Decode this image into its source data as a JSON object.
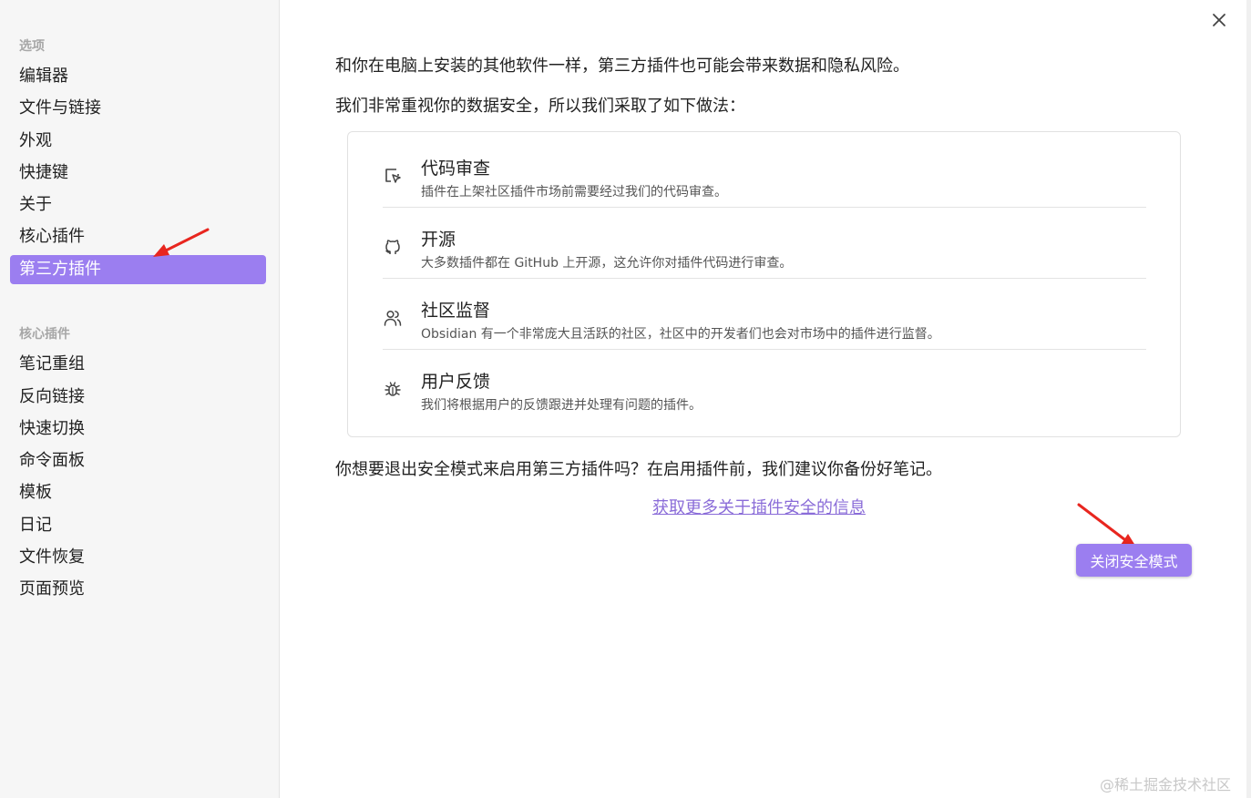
{
  "sidebar": {
    "section_options": "选项",
    "options_items": [
      "编辑器",
      "文件与链接",
      "外观",
      "快捷键",
      "关于",
      "核心插件",
      "第三方插件"
    ],
    "section_core_plugins": "核心插件",
    "core_items": [
      "笔记重组",
      "反向链接",
      "快速切换",
      "命令面板",
      "模板",
      "日记",
      "文件恢复",
      "页面预览"
    ]
  },
  "main": {
    "intro_line1": "和你在电脑上安装的其他软件一样，第三方插件也可能会带来数据和隐私风险。",
    "intro_line2": "我们非常重视你的数据安全，所以我们采取了如下做法：",
    "measures": [
      {
        "icon": "code-review-icon",
        "title": "代码审查",
        "desc": "插件在上架社区插件市场前需要经过我们的代码审查。"
      },
      {
        "icon": "github-icon",
        "title": "开源",
        "desc": "大多数插件都在 GitHub 上开源，这允许你对插件代码进行审查。"
      },
      {
        "icon": "users-icon",
        "title": "社区监督",
        "desc": "Obsidian 有一个非常庞大且活跃的社区，社区中的开发者们也会对市场中的插件进行监督。"
      },
      {
        "icon": "bug-icon",
        "title": "用户反馈",
        "desc": "我们将根据用户的反馈跟进并处理有问题的插件。"
      }
    ],
    "question": "你想要退出安全模式来启用第三方插件吗？在启用插件前，我们建议你备份好笔记。",
    "learn_more_link": "获取更多关于插件安全的信息",
    "turn_off_button": "关闭安全模式"
  },
  "watermark": "@稀土掘金技术社区",
  "colors": {
    "accent": "#9b7ef0",
    "link": "#8a6cd8",
    "annotation_arrow": "#e8261f"
  }
}
